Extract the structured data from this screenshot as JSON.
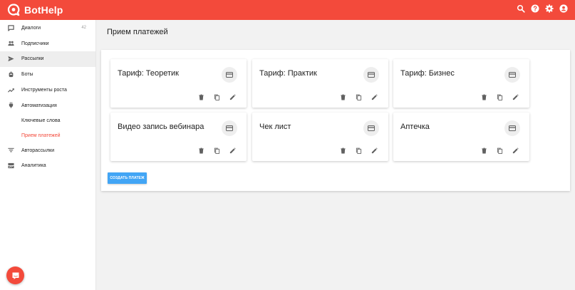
{
  "brand": {
    "name": "BotHelp",
    "color": "#f34a3b"
  },
  "header": {
    "icons": [
      "search-icon",
      "help-icon",
      "settings-icon",
      "account-icon"
    ]
  },
  "sidebar": {
    "items": [
      {
        "label": "Диалоги",
        "icon": "chat-icon",
        "badge": "42"
      },
      {
        "label": "Подписчики",
        "icon": "people-icon"
      },
      {
        "label": "Рассылки",
        "icon": "send-icon",
        "active": true
      },
      {
        "label": "Боты",
        "icon": "bot-icon"
      },
      {
        "label": "Инструменты роста",
        "icon": "trending-up-icon"
      },
      {
        "label": "Автоматизация",
        "icon": "plug-icon"
      }
    ],
    "sub_items": [
      {
        "label": "Ключевые слова"
      },
      {
        "label": "Прием платежей",
        "current": true
      }
    ],
    "items_bottom": [
      {
        "label": "Авторассылки",
        "icon": "filter-list-icon"
      },
      {
        "label": "Аналитика",
        "icon": "analytics-icon"
      }
    ]
  },
  "main": {
    "title": "Прием платежей",
    "cards": [
      {
        "title": "Тариф: Теоретик"
      },
      {
        "title": "Тариф: Практик"
      },
      {
        "title": "Тариф: Бизнес"
      },
      {
        "title": "Видео запись вебинара"
      },
      {
        "title": "Чек лист"
      },
      {
        "title": "Аптечка"
      }
    ],
    "create_button": "СОЗДАТЬ ПЛАТЕЖ"
  },
  "colors": {
    "accent": "#f34a3b",
    "button": "#42a5f5",
    "icon": "#616161"
  }
}
